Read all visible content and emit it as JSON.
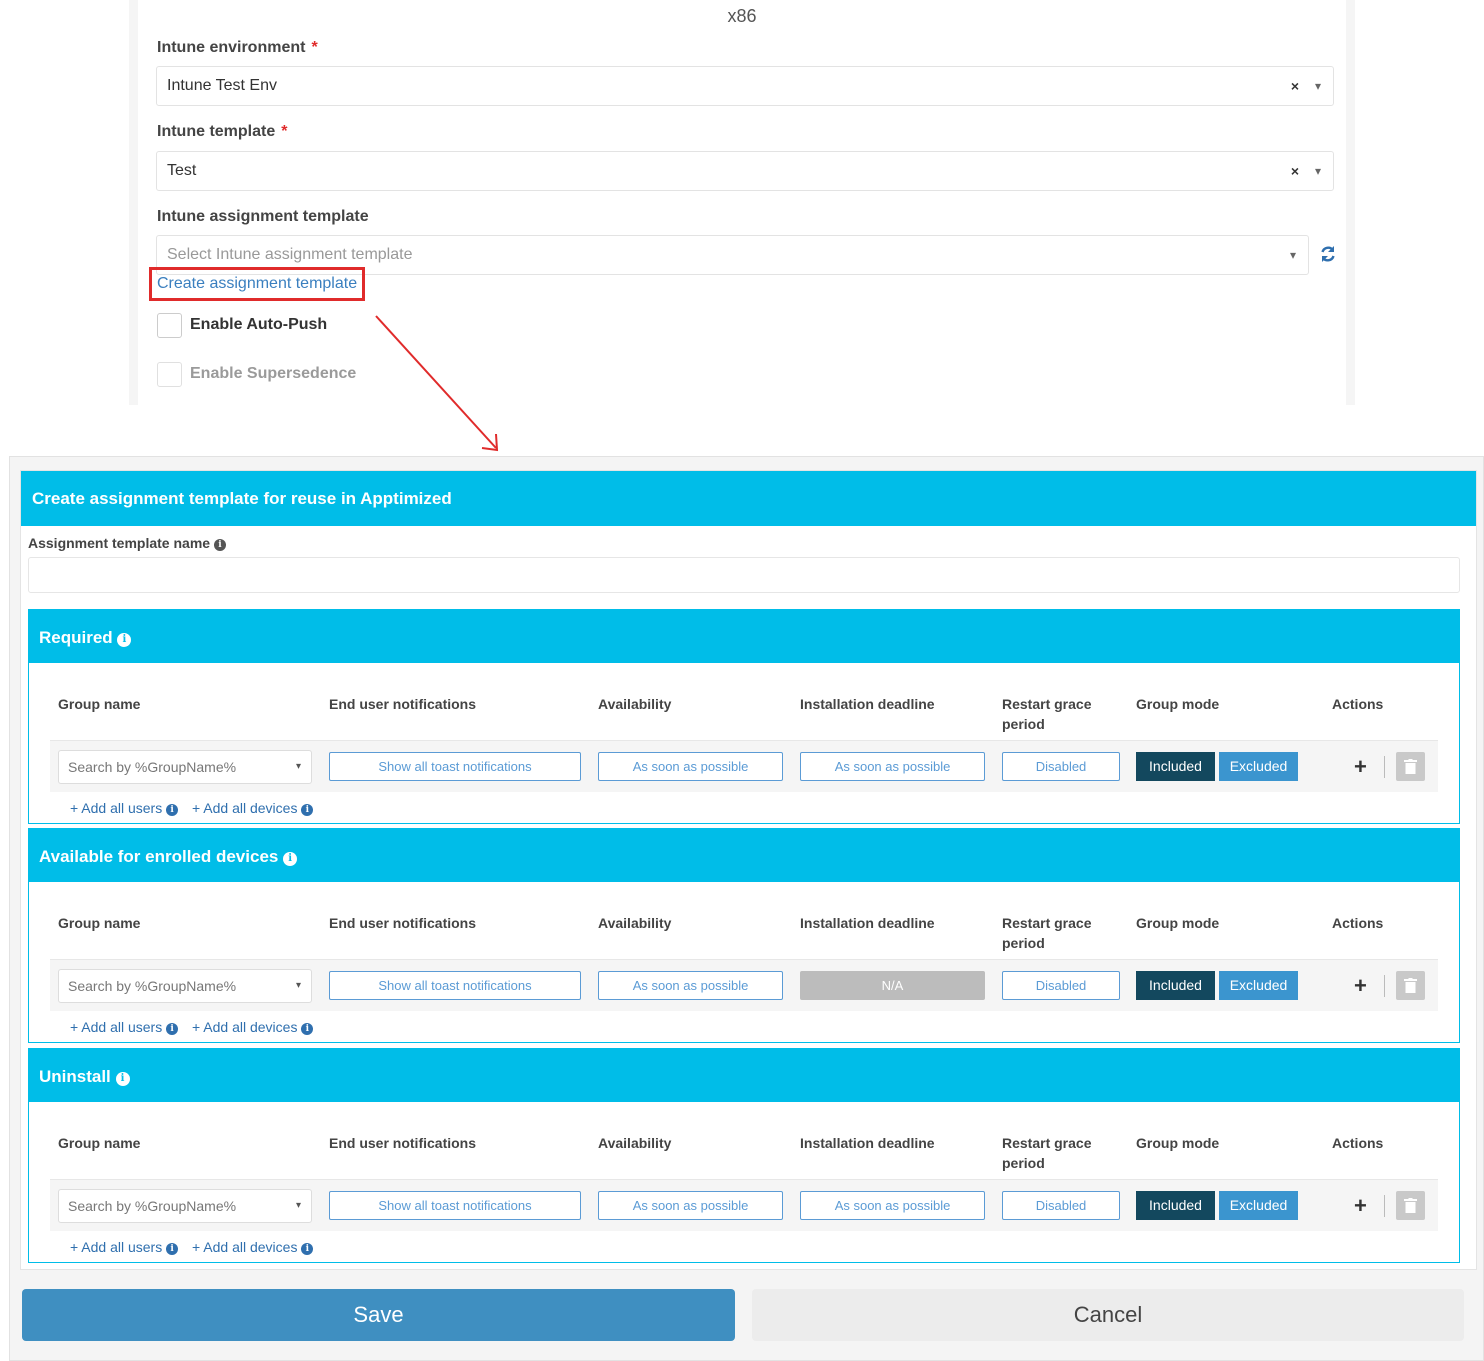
{
  "top": {
    "arch_value": "x86",
    "env_label": "Intune environment",
    "env_value": "Intune Test Env",
    "tmpl_label": "Intune template",
    "tmpl_value": "Test",
    "assign_label": "Intune assignment template",
    "assign_placeholder": "Select Intune assignment template",
    "create_link": "Create assignment template",
    "auto_push_label": "Enable Auto-Push",
    "supersedence_label": "Enable Supersedence",
    "required_marker": "*",
    "clear_glyph": "×",
    "caret_glyph": "▾"
  },
  "modal": {
    "title": "Create assignment template for reuse in Apptimized",
    "name_label": "Assignment template name",
    "info_glyph": "i",
    "columns": {
      "group_name": "Group name",
      "notifications": "End user notifications",
      "availability": "Availability",
      "deadline": "Installation deadline",
      "restart": "Restart grace period",
      "group_mode": "Group mode",
      "actions": "Actions"
    },
    "sections": [
      {
        "title": "Required",
        "group_placeholder": "Search by %GroupName%",
        "notifications": "Show all toast notifications",
        "availability": "As soon as possible",
        "deadline": "As soon as possible",
        "restart": "Disabled",
        "included": "Included",
        "excluded": "Excluded",
        "add_users": "+ Add all users",
        "add_devices": "+ Add all devices"
      },
      {
        "title": "Available for enrolled devices",
        "group_placeholder": "Search by %GroupName%",
        "notifications": "Show all toast notifications",
        "availability": "As soon as possible",
        "deadline": "N/A",
        "restart": "Disabled",
        "included": "Included",
        "excluded": "Excluded",
        "add_users": "+ Add all users",
        "add_devices": "+ Add all devices"
      },
      {
        "title": "Uninstall",
        "group_placeholder": "Search by %GroupName%",
        "notifications": "Show all toast notifications",
        "availability": "As soon as possible",
        "deadline": "As soon as possible",
        "restart": "Disabled",
        "included": "Included",
        "excluded": "Excluded",
        "add_users": "+ Add all users",
        "add_devices": "+ Add all devices"
      }
    ],
    "plus_glyph": "+",
    "save_label": "Save",
    "cancel_label": "Cancel"
  },
  "colors": {
    "header_cyan": "#00bde8",
    "included_dark": "#13485e",
    "excluded_blue": "#3b95cf",
    "link_blue": "#3a7fbf",
    "highlight_red": "#e02b2b"
  },
  "icons": [
    "refresh-icon",
    "info-icon",
    "chevron-down-icon",
    "clear-icon",
    "plus-icon",
    "trash-icon",
    "arrow-annotation"
  ]
}
